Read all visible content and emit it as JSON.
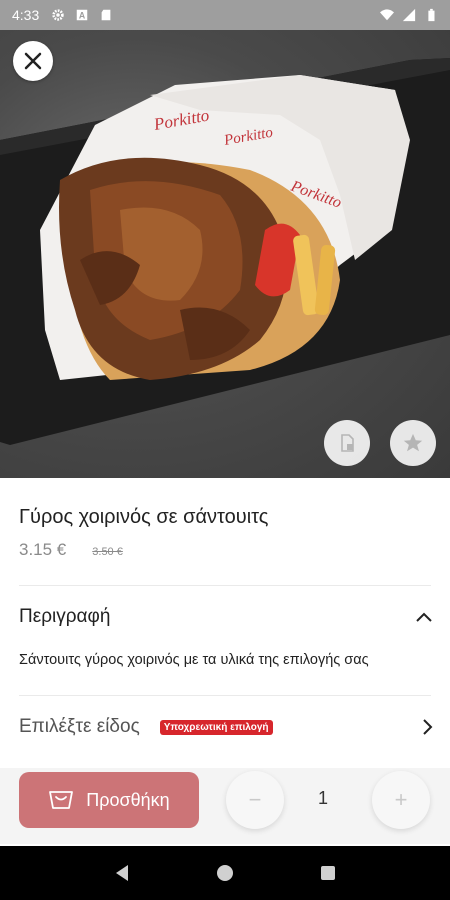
{
  "status_bar": {
    "time": "4:33",
    "icons_left": [
      "gear-icon",
      "a-box-icon",
      "sd-card-icon"
    ],
    "icons_right": [
      "wifi-icon",
      "signal-icon",
      "battery-icon"
    ]
  },
  "hero": {
    "wrapper_brand_text": "Porkitto",
    "buttons": [
      "close-icon",
      "document-icon",
      "star-icon"
    ]
  },
  "product": {
    "title": "Γύρος χοιρινός σε σάντουιτς",
    "price": "3.15 €",
    "old_price": "3.50 €"
  },
  "description": {
    "heading": "Περιγραφή",
    "text": "Σάντουιτς γύρος χοιρινός με τα υλικά της επιλογής σας",
    "expanded": true
  },
  "options": {
    "label": "Επιλέξτε είδος",
    "badge": "Υποχρεωτική επιλογή"
  },
  "cart": {
    "add_label": "Προσθήκη",
    "minus": "−",
    "plus": "+",
    "quantity": "1"
  },
  "colors": {
    "accent": "#cc7477",
    "badge": "#d7262c",
    "status_bar": "#9e9e9e"
  }
}
